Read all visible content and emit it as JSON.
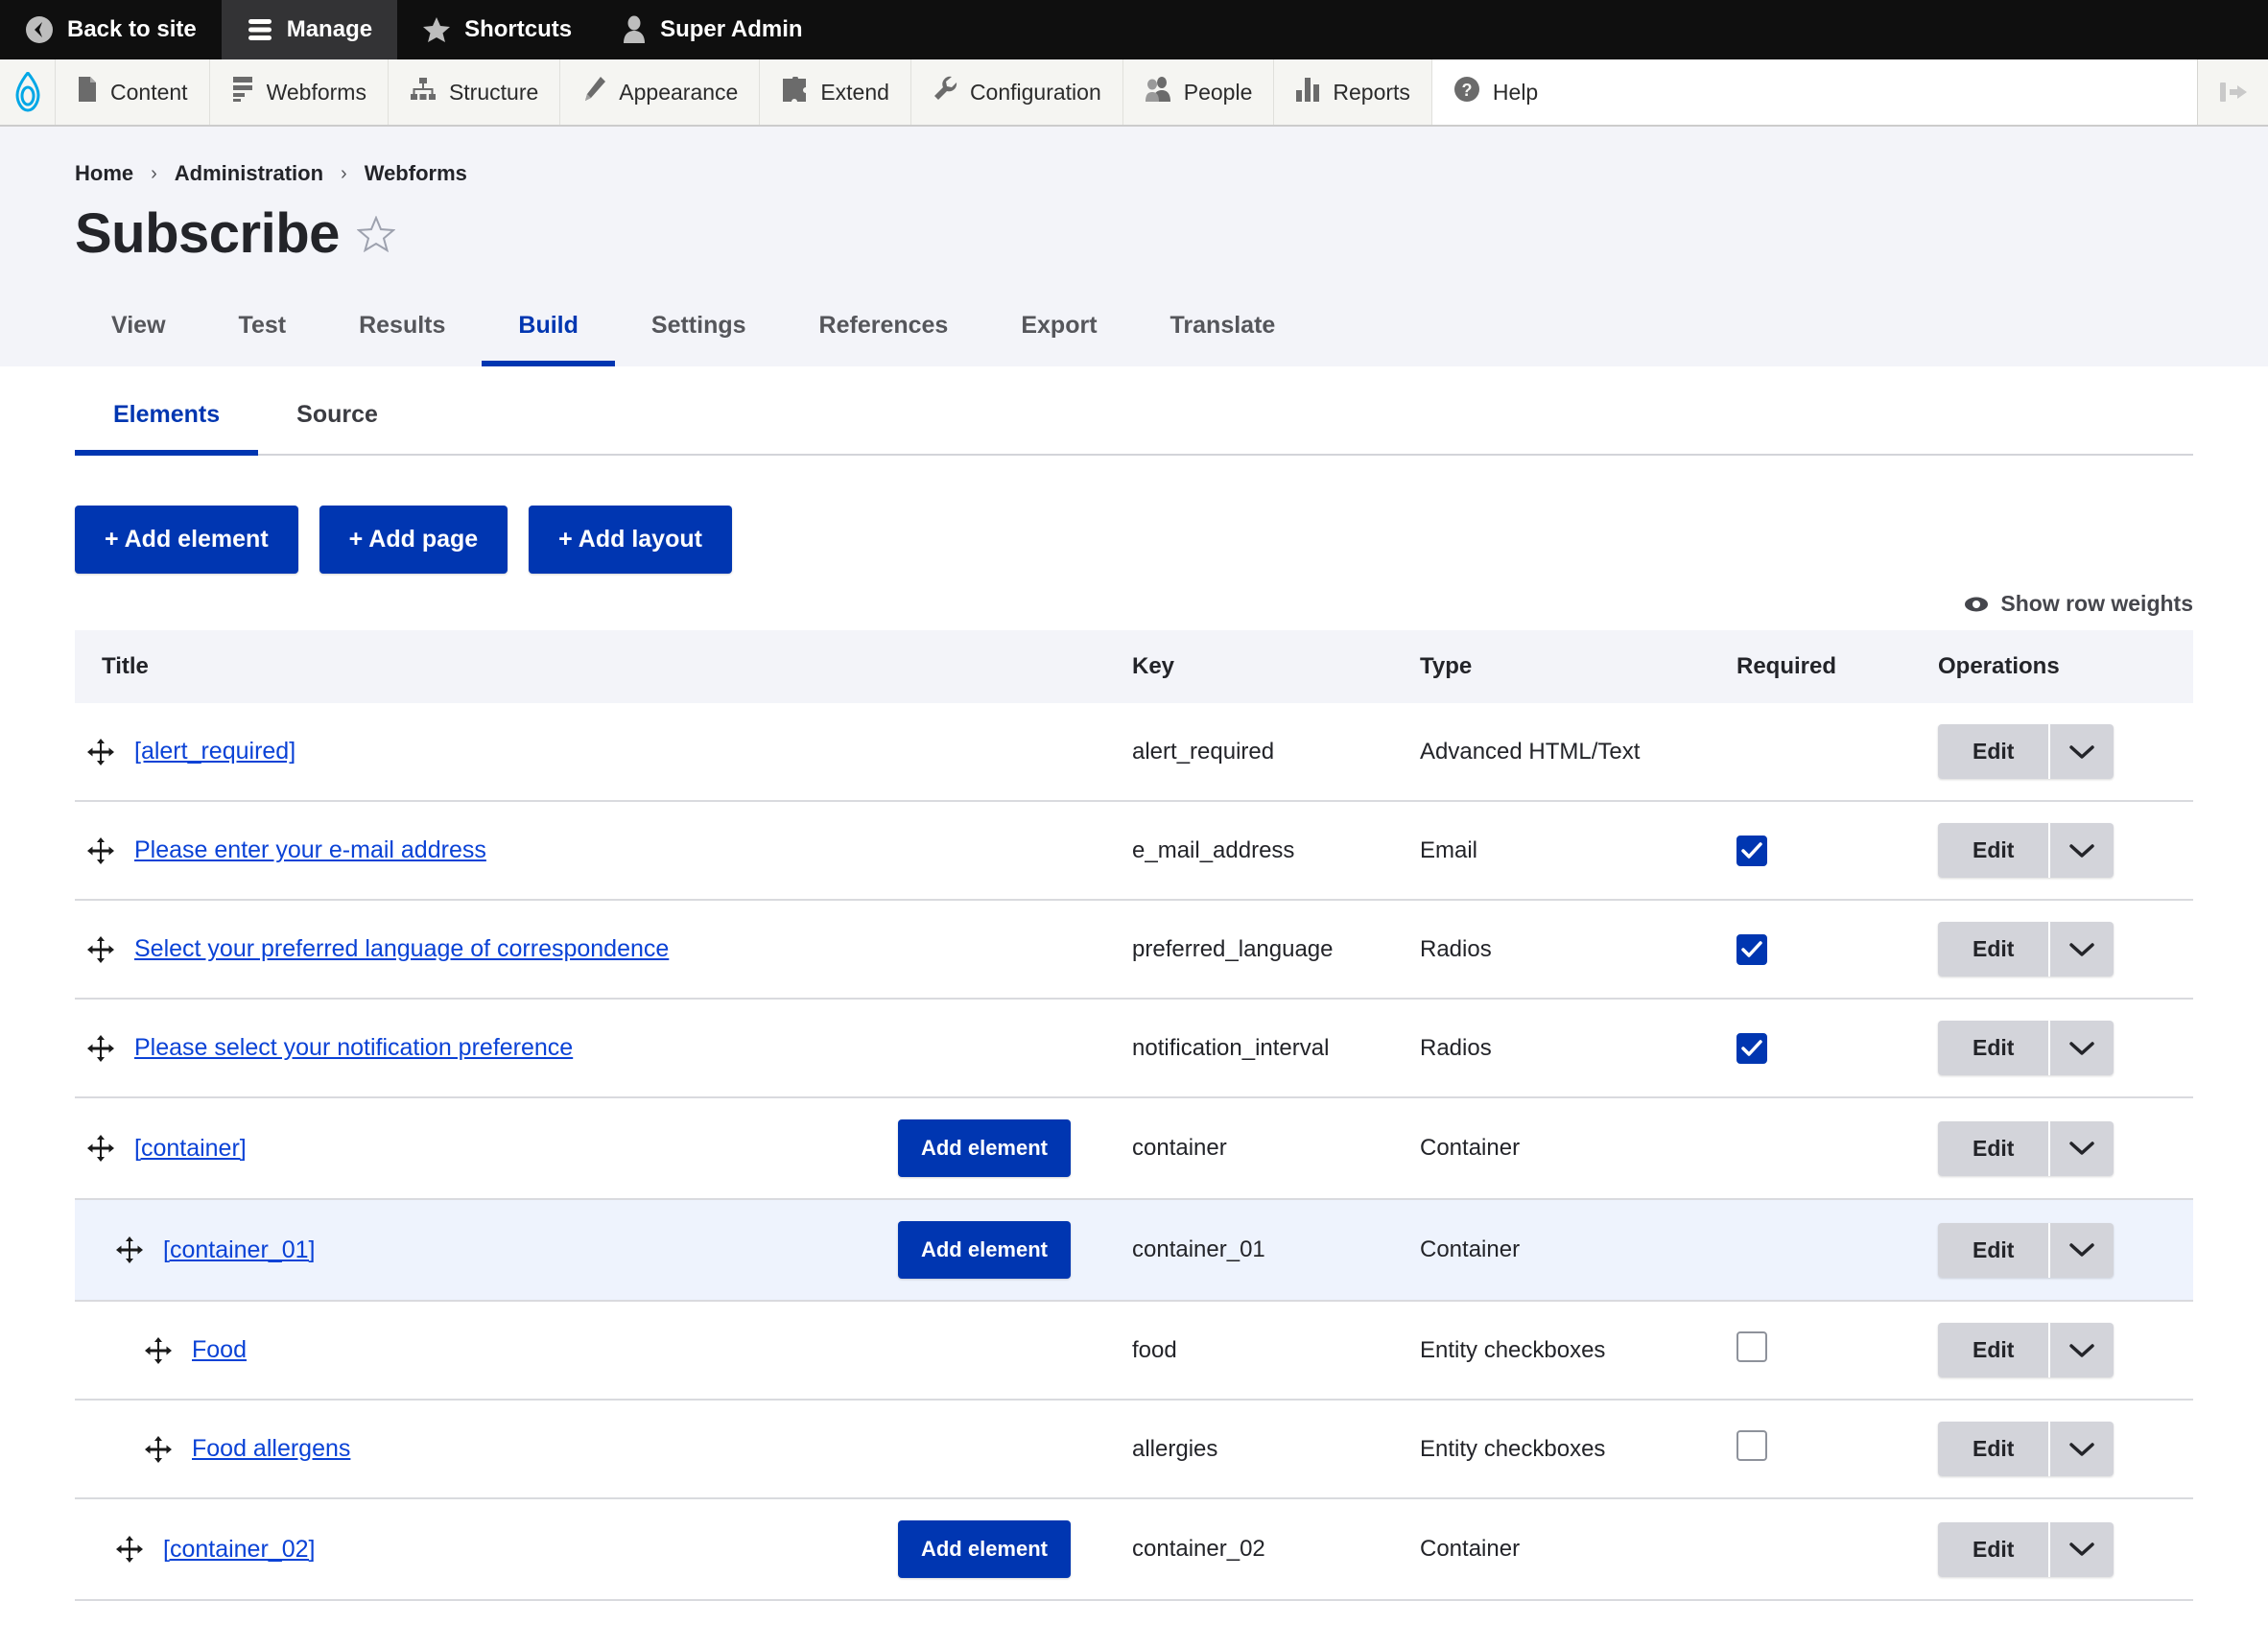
{
  "admin_bar": {
    "items": [
      {
        "label": "Back to site",
        "icon": "back-circle-icon",
        "active": false
      },
      {
        "label": "Manage",
        "icon": "hamburger-icon",
        "active": true
      },
      {
        "label": "Shortcuts",
        "icon": "star-icon",
        "active": false
      },
      {
        "label": "Super Admin",
        "icon": "user-icon",
        "active": false
      }
    ]
  },
  "toolbar": {
    "logo": "drupal-drop-logo",
    "items": [
      {
        "label": "Content",
        "icon": "file-icon"
      },
      {
        "label": "Webforms",
        "icon": "webform-icon"
      },
      {
        "label": "Structure",
        "icon": "sitemap-icon"
      },
      {
        "label": "Appearance",
        "icon": "paintbrush-icon"
      },
      {
        "label": "Extend",
        "icon": "puzzle-icon"
      },
      {
        "label": "Configuration",
        "icon": "wrench-icon"
      },
      {
        "label": "People",
        "icon": "people-icon"
      },
      {
        "label": "Reports",
        "icon": "bar-chart-icon"
      },
      {
        "label": "Help",
        "icon": "question-circle-icon"
      }
    ],
    "collapse_icon": "collapse-toolbar-icon"
  },
  "breadcrumb": {
    "items": [
      "Home",
      "Administration",
      "Webforms"
    ],
    "separator": "›"
  },
  "header": {
    "title": "Subscribe",
    "favorite_icon": "star-outline-icon"
  },
  "primary_tabs": [
    {
      "label": "View",
      "active": false
    },
    {
      "label": "Test",
      "active": false
    },
    {
      "label": "Results",
      "active": false
    },
    {
      "label": "Build",
      "active": true
    },
    {
      "label": "Settings",
      "active": false
    },
    {
      "label": "References",
      "active": false
    },
    {
      "label": "Export",
      "active": false
    },
    {
      "label": "Translate",
      "active": false
    }
  ],
  "secondary_tabs": [
    {
      "label": "Elements",
      "active": true
    },
    {
      "label": "Source",
      "active": false
    }
  ],
  "actions": {
    "add_element": "+ Add element",
    "add_page": "+ Add page",
    "add_layout": "+ Add layout",
    "show_row_weights": "Show row weights",
    "row_weights_icon": "eye-icon"
  },
  "table": {
    "columns": [
      "Title",
      "Key",
      "Type",
      "Required",
      "Operations"
    ],
    "ops_edit_label": "Edit",
    "ops_caret_icon": "chevron-down-icon",
    "add_element_label": "Add element",
    "drag_icon": "drag-move-icon",
    "rows": [
      {
        "title": "[alert_required]",
        "key": "alert_required",
        "type": "Advanced HTML/Text",
        "indent": 0,
        "required": null,
        "has_add_element": false,
        "highlight": false
      },
      {
        "title": "Please enter your e-mail address",
        "key": "e_mail_address",
        "type": "Email",
        "indent": 0,
        "required": true,
        "has_add_element": false,
        "highlight": false
      },
      {
        "title": "Select your preferred language of correspondence",
        "key": "preferred_language",
        "type": "Radios",
        "indent": 0,
        "required": true,
        "has_add_element": false,
        "highlight": false
      },
      {
        "title": "Please select your notification preference",
        "key": "notification_interval",
        "type": "Radios",
        "indent": 0,
        "required": true,
        "has_add_element": false,
        "highlight": false
      },
      {
        "title": "[container]",
        "key": "container",
        "type": "Container",
        "indent": 0,
        "required": null,
        "has_add_element": true,
        "highlight": false
      },
      {
        "title": "[container_01]",
        "key": "container_01",
        "type": "Container",
        "indent": 1,
        "required": null,
        "has_add_element": true,
        "highlight": true
      },
      {
        "title": "Food",
        "key": "food",
        "type": "Entity checkboxes",
        "indent": 2,
        "required": false,
        "has_add_element": false,
        "highlight": false
      },
      {
        "title": "Food allergens",
        "key": "allergies",
        "type": "Entity checkboxes",
        "indent": 2,
        "required": false,
        "has_add_element": false,
        "highlight": false
      },
      {
        "title": "[container_02]",
        "key": "container_02",
        "type": "Container",
        "indent": 1,
        "required": null,
        "has_add_element": true,
        "highlight": false
      }
    ]
  },
  "colors": {
    "brand_blue": "#0036b1",
    "link_blue": "#0a42d6",
    "admin_bar_bg": "#0f0f0f",
    "toolbar_bg": "#f5f5f2",
    "page_bg": "#f3f4f9",
    "row_highlight": "#eef3fd"
  }
}
